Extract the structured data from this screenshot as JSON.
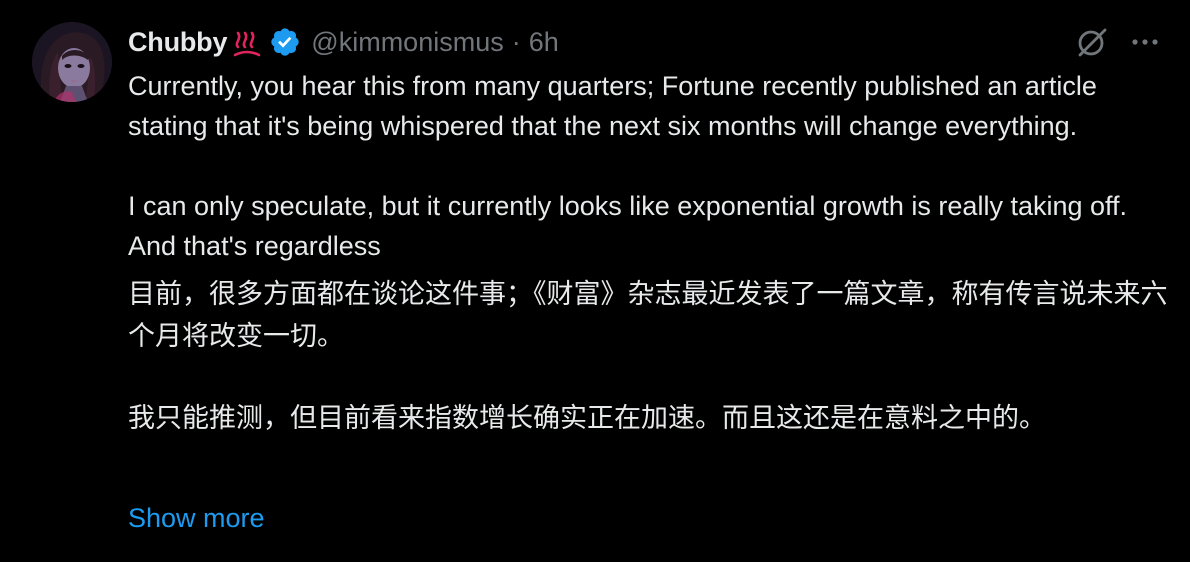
{
  "author": {
    "name": "Chubby",
    "handle": "@kimmonismus",
    "separator": "·",
    "time": "6h",
    "emoji_icon": "hot-springs-icon",
    "badge_icon": "verified-badge-icon",
    "badge_color": "#1d9bf0"
  },
  "actions": {
    "grok_icon": "grok-icon",
    "more_icon": "more-options-icon"
  },
  "post": {
    "en_para_1": "Currently, you hear this from many quarters; Fortune recently published an article stating that it's being whispered that the next six months will change everything.",
    "en_para_2": "I can only speculate, but it currently looks like exponential growth is really taking off. And that's regardless",
    "zh_para_1": "目前，很多方面都在谈论这件事；《财富》杂志最近发表了一篇文章，称有传言说未来六个月将改变一切。",
    "zh_para_2": "我只能推测，但目前看来指数增长确实正在加速。而且这还是在意料之中的。"
  },
  "show_more_label": "Show more",
  "colors": {
    "background": "#000000",
    "text": "#e7e9ea",
    "muted": "#71767b",
    "link": "#1d9bf0"
  }
}
